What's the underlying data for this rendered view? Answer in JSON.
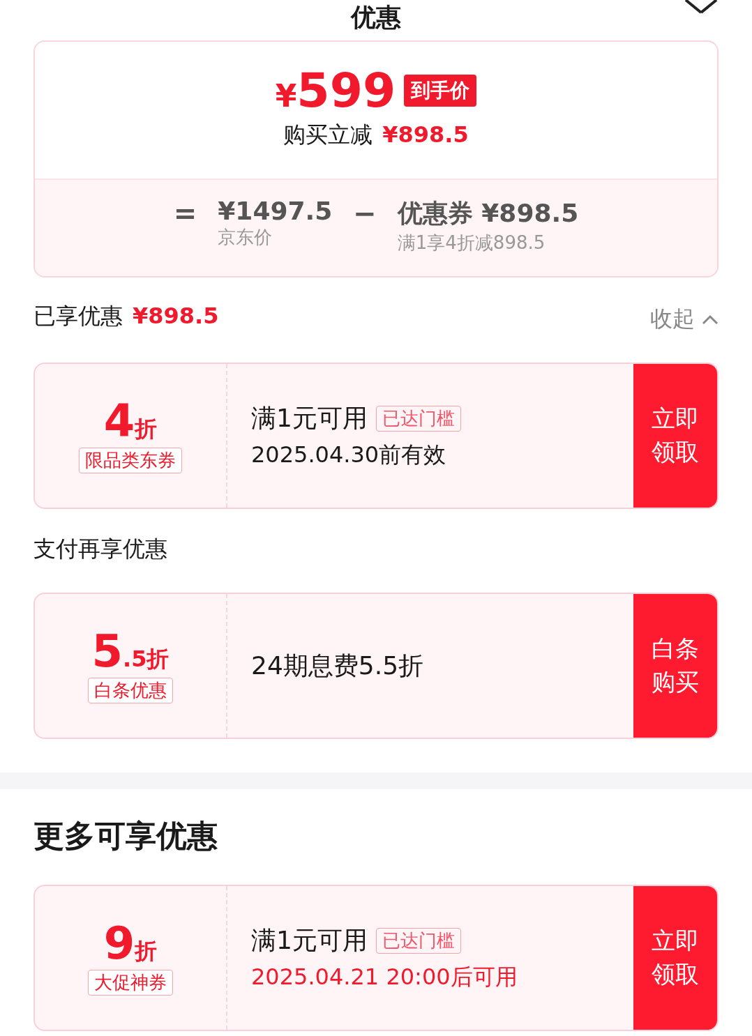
{
  "header": {
    "title": "优惠"
  },
  "price_card": {
    "currency": "¥",
    "price": "599",
    "badge": "到手价",
    "reduce_label": "购买立减",
    "reduce_amount": "¥898.5",
    "formula": {
      "equals": "=",
      "base_amount": "¥1497.5",
      "base_label": "京东价",
      "minus": "−",
      "coupon_label": "优惠券",
      "coupon_amount": "¥898.5",
      "coupon_note": "满1享4折减898.5"
    }
  },
  "enjoyed": {
    "label": "已享优惠",
    "amount": "¥898.5",
    "toggle": "收起",
    "expanded": true
  },
  "coupons": [
    {
      "big": "4",
      "small": "折",
      "tag": "限品类东券",
      "condition": "满1元可用",
      "badge": "已达门槛",
      "note": "2025.04.30前有效",
      "note_highlight": false,
      "action": "立即领取"
    }
  ],
  "pay_section": {
    "title": "支付再享优惠",
    "coupons": [
      {
        "big": "5",
        "small": ".5折",
        "tag": "白条优惠",
        "condition": "24期息费5.5折",
        "action": "白条购买"
      }
    ]
  },
  "more_section": {
    "title": "更多可享优惠",
    "coupons": [
      {
        "big": "9",
        "small": "折",
        "tag": "大促神券",
        "condition": "满1元可用",
        "badge": "已达门槛",
        "note": "2025.04.21 20:00后可用",
        "note_highlight": true,
        "action": "立即领取"
      }
    ]
  }
}
